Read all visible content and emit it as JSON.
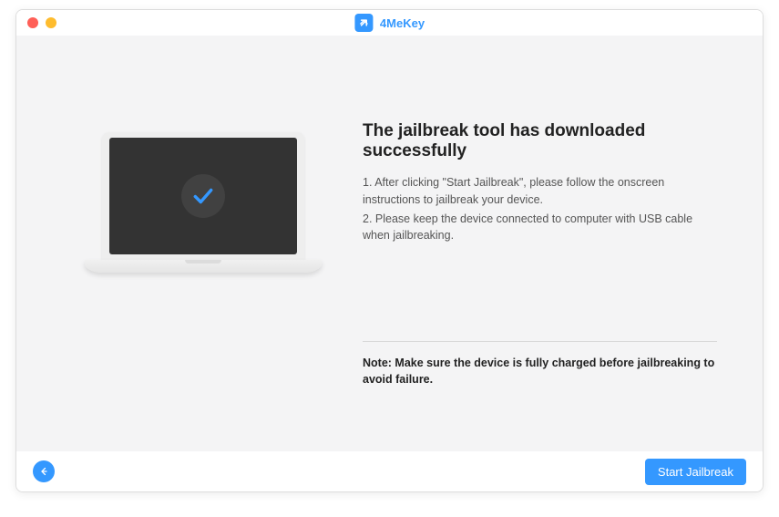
{
  "app": {
    "name": "4MeKey"
  },
  "main": {
    "heading": "The jailbreak tool has downloaded successfully",
    "instruction1": "1. After clicking \"Start Jailbreak\", please follow the onscreen instructions to jailbreak your device.",
    "instruction2": "2. Please keep the device connected to computer with USB cable when jailbreaking.",
    "note": "Note: Make sure the device is fully charged before jailbreaking to avoid failure."
  },
  "footer": {
    "primary_button": "Start Jailbreak"
  }
}
